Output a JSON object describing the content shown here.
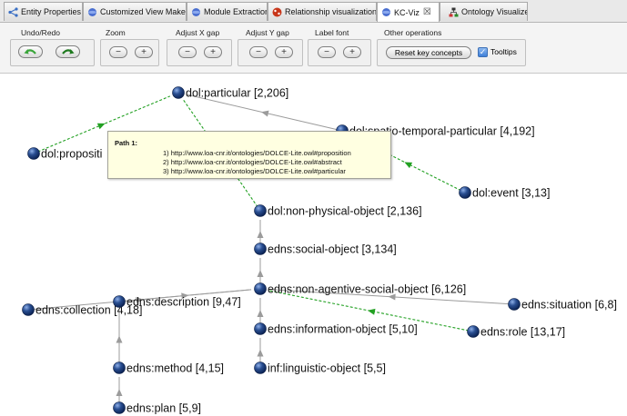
{
  "tabs": [
    {
      "label": "Entity Properties",
      "icon": "share-icon",
      "active": false
    },
    {
      "label": "Customized View Maker",
      "icon": "blue-sphere-icon",
      "active": false
    },
    {
      "label": "Module Extraction",
      "icon": "blue-sphere-icon",
      "active": false
    },
    {
      "label": "Relationship visualization",
      "icon": "red-graph-icon",
      "active": false
    },
    {
      "label": "KC-Viz",
      "icon": "blue-sphere-icon",
      "active": true,
      "close": "☒"
    },
    {
      "label": "Ontology Visualizer",
      "icon": "hierarchy-icon",
      "active": false
    }
  ],
  "toolbar": {
    "undo_redo_label": "Undo/Redo",
    "zoom_label": "Zoom",
    "adjust_x_label": "Adjust X gap",
    "adjust_y_label": "Adjust Y gap",
    "label_font_label": "Label font",
    "other_label": "Other operations",
    "minus": "−",
    "plus": "+",
    "reset_label": "Reset key concepts",
    "tooltips_label": "Tooltips",
    "tooltips_checked": true
  },
  "graph": {
    "nodes": [
      {
        "id": "particular",
        "label": "dol:particular [2,206]"
      },
      {
        "id": "spatio",
        "label": "dol:spatio-temporal-particular [4,192]"
      },
      {
        "id": "proposition",
        "label": "dol:propositi"
      },
      {
        "id": "event",
        "label": "dol:event [3,13]"
      },
      {
        "id": "npo",
        "label": "dol:non-physical-object [2,136]"
      },
      {
        "id": "social",
        "label": "edns:social-object [3,134]"
      },
      {
        "id": "nason",
        "label": "edns:non-agentive-social-object [6,126]"
      },
      {
        "id": "collection",
        "label": "edns:collection [4,18]"
      },
      {
        "id": "situation",
        "label": "edns:situation [6,8]"
      },
      {
        "id": "description",
        "label": "edns:description [9,47]"
      },
      {
        "id": "infobj",
        "label": "edns:information-object [5,10]"
      },
      {
        "id": "role",
        "label": "edns:role [13,17]"
      },
      {
        "id": "method",
        "label": "edns:method [4,15]"
      },
      {
        "id": "linguistic",
        "label": "inf:linguistic-object [5,5]"
      },
      {
        "id": "plan",
        "label": "edns:plan [5,9]"
      }
    ],
    "colors": {
      "node": "#1d3f78",
      "solid_edge": "#9b9b9b",
      "dashed_edge": "#22a022"
    }
  },
  "tooltip": {
    "title": "Path 1:",
    "lines": [
      "1) http://www.loa-cnr.it/ontologies/DOLCE-Lite.owl#proposition",
      "2) http://www.loa-cnr.it/ontologies/DOLCE-Lite.owl#abstract",
      "3) http://www.loa-cnr.it/ontologies/DOLCE-Lite.owl#particular"
    ]
  }
}
